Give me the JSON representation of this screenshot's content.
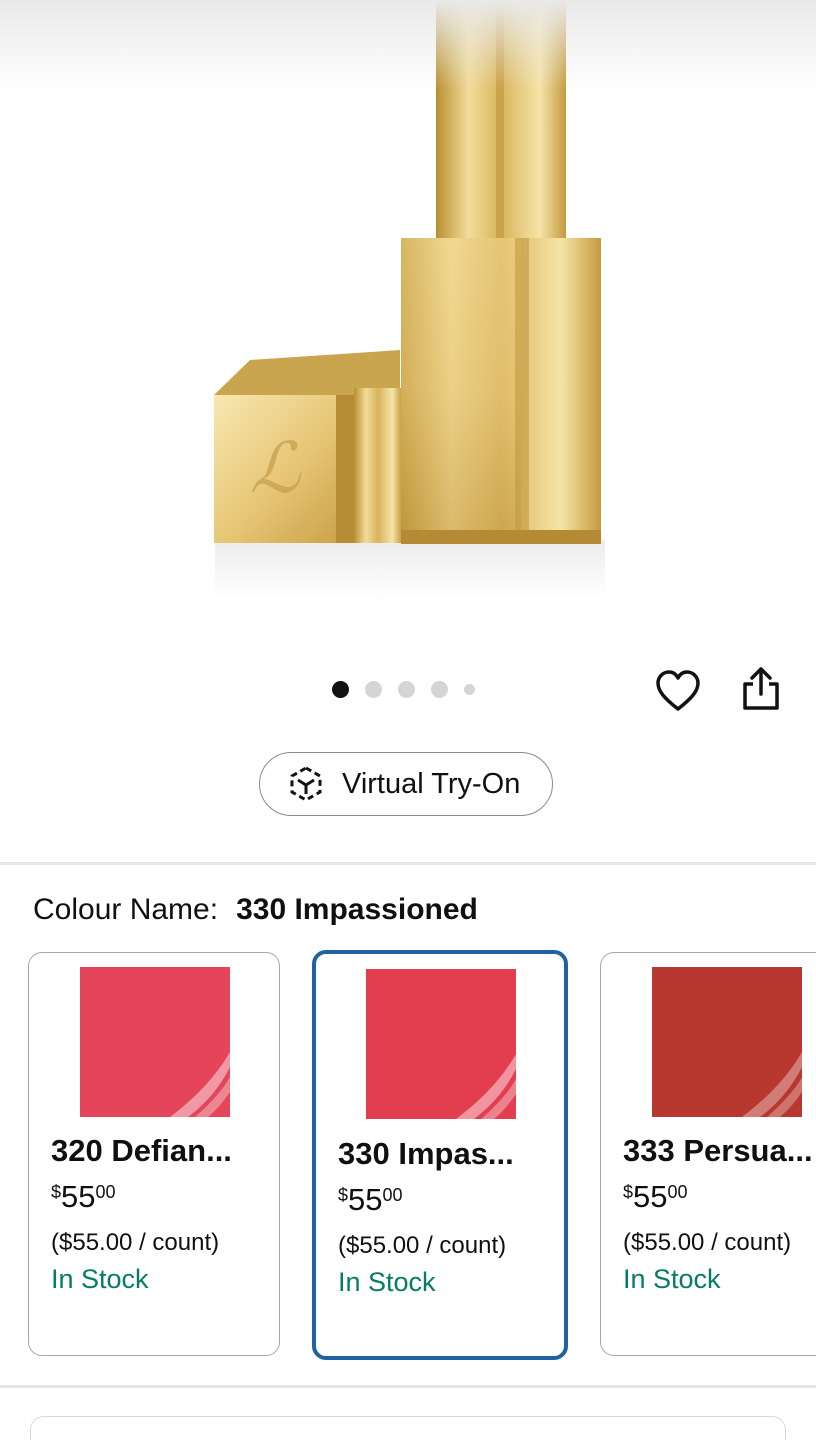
{
  "icons": {
    "close": "close-icon",
    "wishlist": "heart-icon",
    "share": "share-icon",
    "try_on": "cube-icon"
  },
  "carousel": {
    "count": 5,
    "active_index": 0
  },
  "try_on": {
    "label": "Virtual Try-On"
  },
  "colour": {
    "label": "Colour Name:",
    "value": "330 Impassioned"
  },
  "swatches": [
    {
      "name": "320 Defian...",
      "currency": "$",
      "price_whole": "55",
      "price_fraction": "00",
      "unit_price": "($55.00 / count)",
      "stock": "In Stock",
      "color": "#e4455a",
      "selected": false
    },
    {
      "name": "330 Impas...",
      "currency": "$",
      "price_whole": "55",
      "price_fraction": "00",
      "unit_price": "($55.00 / count)",
      "stock": "In Stock",
      "color": "#e33e50",
      "selected": true
    },
    {
      "name": "333 Persua...",
      "currency": "$",
      "price_whole": "55",
      "price_fraction": "00",
      "unit_price": "($55.00 / count)",
      "stock": "In Stock",
      "color": "#b8382f",
      "selected": false
    }
  ],
  "colors": {
    "selected_border": "#2162a1",
    "in_stock": "#067d62",
    "gold": "#d9b45a"
  }
}
